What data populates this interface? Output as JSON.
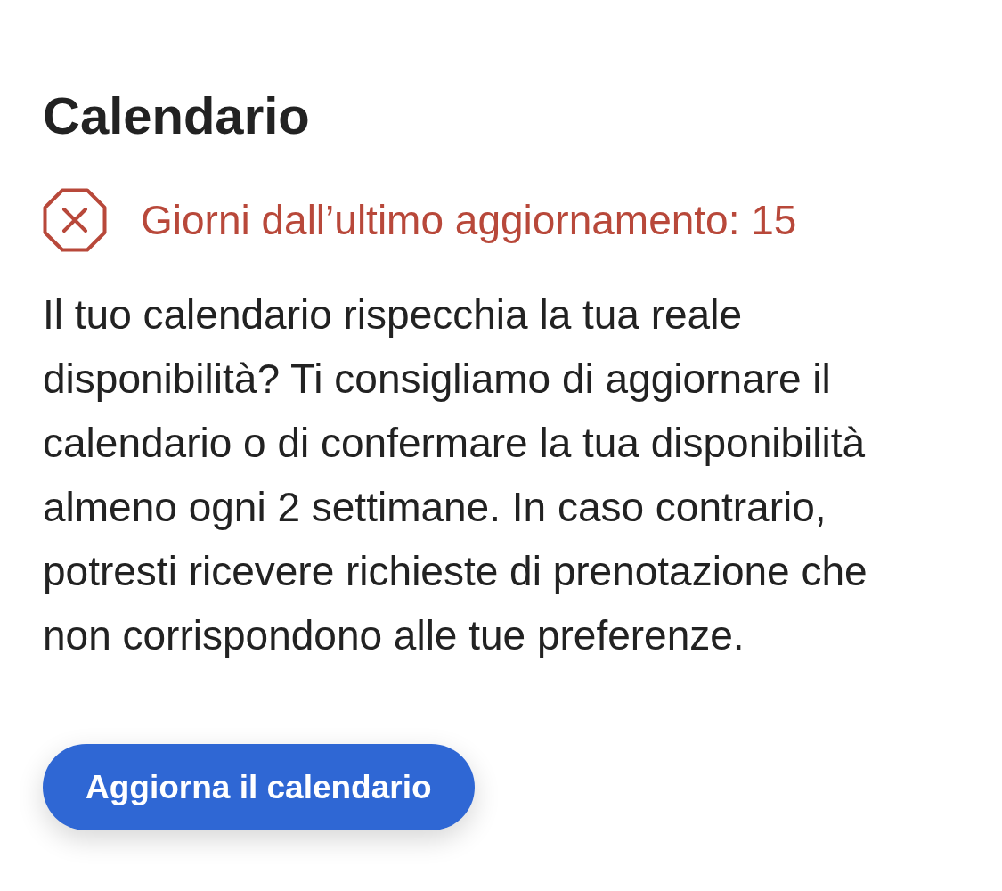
{
  "title": "Calendario",
  "status": {
    "kind": "error",
    "text": "Giorni dall’ultimo aggiornamento: 15"
  },
  "description": "Il tuo calendario rispecchia la tua reale disponibilità? Ti consigliamo di aggiornare il calendario o di confermare la tua disponibilità almeno ogni 2 settimane. In caso contrario, potresti ricevere richieste di prenotazione che non corrispondono alle tue preferenze.",
  "button": {
    "label": "Aggiorna il calendario"
  }
}
